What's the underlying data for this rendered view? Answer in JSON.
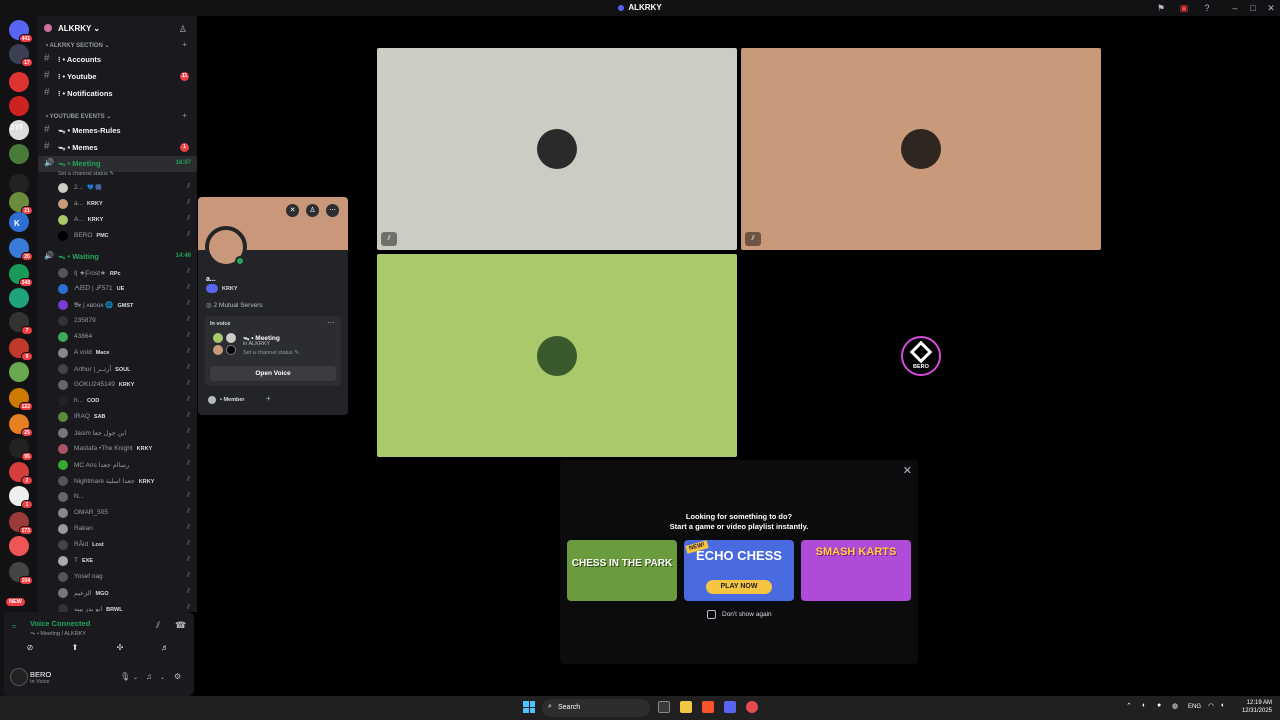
{
  "window": {
    "title": "ALKRKY"
  },
  "guilds": [
    {
      "badge": "441"
    },
    {
      "badge": "17"
    },
    {
      "badge": ""
    },
    {
      "badge": ""
    },
    {
      "badge": ""
    },
    {
      "badge": ""
    },
    {
      "badge": ""
    },
    {
      "badge": "21"
    },
    {
      "badge": ""
    },
    {
      "badge": "26"
    },
    {
      "badge": "348"
    },
    {
      "badge": ""
    },
    {
      "badge": "7"
    },
    {
      "badge": "9"
    },
    {
      "badge": ""
    },
    {
      "badge": "122"
    },
    {
      "badge": "25"
    },
    {
      "badge": "95"
    },
    {
      "badge": "2"
    },
    {
      "badge": "1"
    },
    {
      "badge": "173"
    },
    {
      "badge": ""
    },
    {
      "badge": "104"
    }
  ],
  "guild_labels": {
    "three_yf": "3Yf",
    "k": "K",
    "new": "NEW"
  },
  "server": {
    "name": "ALKRKY"
  },
  "sidebar": {
    "cat1": "• ALKRKY SECTION",
    "cat2": "• YOUTUBE EVENTS",
    "channels": [
      {
        "label": "⁝ • Accounts",
        "badge": ""
      },
      {
        "label": "⁝ • Youtube",
        "badge": "11"
      },
      {
        "label": "⁝ • Notifications",
        "badge": ""
      },
      {
        "label": "ᯓ • Memes-Rules",
        "badge": ""
      },
      {
        "label": "ᯓ • Memes",
        "badge": "1"
      }
    ],
    "meeting": {
      "label": "ᯓ • Meeting",
      "time": "16:07",
      "status": "Set a channel status ✎"
    },
    "meeting_users": [
      {
        "name": "2...",
        "tag": "💙 🎆"
      },
      {
        "name": "a...",
        "tag": "KRKY"
      },
      {
        "name": "A...",
        "tag": "KRKY"
      },
      {
        "name": "BERO",
        "tag": "PMC"
      }
    ],
    "waiting": {
      "label": "ᯓ • Waiting",
      "time": "14:46"
    },
    "waiting_users": [
      {
        "name": "ⵏ| ★Ƒrost★",
        "tag": "RPc"
      },
      {
        "name": "ᗅᗷᗪ | ℱ571",
        "tag": "UE"
      },
      {
        "name": "𝕭𝖊 | ᴀʙᴅᴏᴀ 🌐",
        "tag": "GMST"
      },
      {
        "name": "235879",
        "tag": ""
      },
      {
        "name": "43864",
        "tag": ""
      },
      {
        "name": "A void",
        "tag": "Mace"
      },
      {
        "name": "Arthur | آرثــر",
        "tag": "SOUL"
      },
      {
        "name": "GOKU245149",
        "tag": "KRKY"
      },
      {
        "name": "h...",
        "tag": "COD"
      },
      {
        "name": "IRAQ",
        "tag": "SAB"
      },
      {
        "name": "Jasim ابن جول جعا",
        "tag": ""
      },
      {
        "name": "Mastafa •The Knight",
        "tag": "KRKY"
      },
      {
        "name": "MC Ans رساام جعدا",
        "tag": ""
      },
      {
        "name": "Nightmare جعدا اسلية",
        "tag": "KRKY"
      },
      {
        "name": "N...",
        "tag": ""
      },
      {
        "name": "OMAR_505",
        "tag": ""
      },
      {
        "name": "Rakan",
        "tag": ""
      },
      {
        "name": "RÃid",
        "tag": "Lost"
      },
      {
        "name": "T",
        "tag": "EXE"
      },
      {
        "name": "Yosef oag",
        "tag": ""
      },
      {
        "name": "الزعيم",
        "tag": "MGO"
      },
      {
        "name": "ابو بدر بيبه",
        "tag": "BRWL"
      }
    ]
  },
  "voice": {
    "status": "Voice Connected",
    "channel": "ᯓ • Meeting / ALKRKY"
  },
  "me": {
    "name": "BERO",
    "status": "In Voice"
  },
  "popout": {
    "name": "a...",
    "tag": "KRKY",
    "mutual": "2 Mutual Servers",
    "section": "In voice",
    "channel": "ᯓ • Meeting",
    "server": "in ALKRKY",
    "status": "Set a channel status ✎",
    "open_button": "Open Voice",
    "member": "• Member",
    "add": "+"
  },
  "tiles": [
    {
      "bg": "#ccccc4",
      "avatar": "#2a2a2a"
    },
    {
      "bg": "#c89a79",
      "avatar": "#2f261f"
    },
    {
      "bg": "#a9c96b",
      "avatar": "#3a5a2c"
    },
    {
      "bg": "#000000",
      "label": "BERO"
    }
  ],
  "activity": {
    "line1": "Looking for something to do?",
    "line2": "Start a game or video playlist instantly.",
    "games": [
      {
        "title": "CHESS IN THE PARK",
        "bg": "#6a9b3c"
      },
      {
        "title": "ECHO CHESS",
        "badge": "NEW!",
        "cta": "PLAY NOW",
        "bg": "#4a6be0"
      },
      {
        "title": "SMASH KARTS",
        "bg": "#b04ad8"
      }
    ],
    "dont_show": "Don't show again"
  },
  "taskbar": {
    "search": "Search",
    "lang": "ENG",
    "time": "12:19 AM",
    "date": "12/31/2025"
  }
}
